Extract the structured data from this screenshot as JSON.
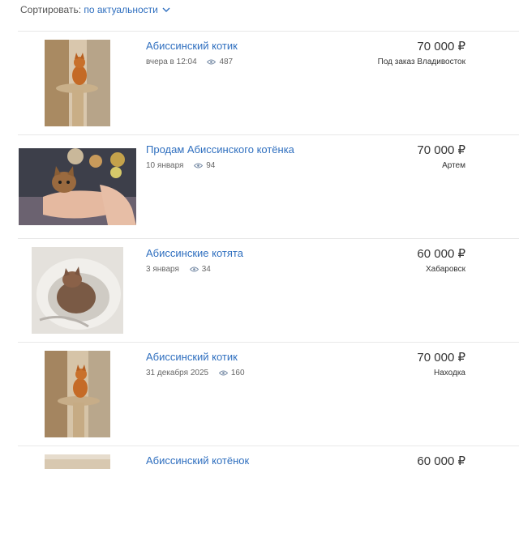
{
  "sort": {
    "label": "Сортировать:",
    "value": "по актуальности",
    "icon": "chevron-down-icon"
  },
  "listings": [
    {
      "title": "Абиссинский котик",
      "date": "вчера в 12:04",
      "views": "487",
      "price": "70 000 ₽",
      "location": "Под заказ Владивосток"
    },
    {
      "title": "Продам Абиссинского котёнка",
      "date": "10 января",
      "views": "94",
      "price": "70 000 ₽",
      "location": "Артем"
    },
    {
      "title": "Абиссинские котята",
      "date": "3 января",
      "views": "34",
      "price": "60 000 ₽",
      "location": "Хабаровск"
    },
    {
      "title": "Абиссинский котик",
      "date": "31 декабря 2025",
      "views": "160",
      "price": "70 000 ₽",
      "location": "Находка"
    },
    {
      "title": "Абиссинский котёнок",
      "price": "60 000 ₽"
    }
  ],
  "colors": {
    "link": "#2f6fbf",
    "text": "#333333",
    "muted": "#666666",
    "divider": "#e8e8e8"
  }
}
